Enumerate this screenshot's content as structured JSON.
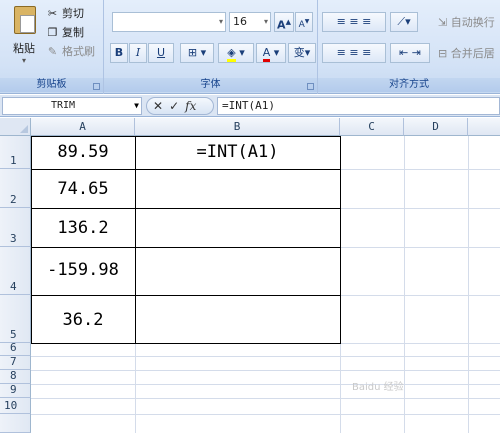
{
  "clipboard": {
    "group_label": "剪贴板",
    "paste_label": "粘贴",
    "cut_label": "剪切",
    "copy_label": "复制",
    "format_painter_label": "格式刷"
  },
  "font": {
    "group_label": "字体",
    "font_name": "",
    "font_size": "16",
    "grow_label": "A",
    "shrink_label": "A",
    "bold_label": "B",
    "italic_label": "I",
    "underline_label": "U",
    "phonetic_label": "变"
  },
  "alignment": {
    "group_label": "对齐方式",
    "wrap_text_label": "自动换行",
    "merge_center_label": "合并后居"
  },
  "formula_bar": {
    "name_box": "TRIM",
    "cancel_glyph": "✕",
    "enter_glyph": "✓",
    "fx_label": "fx",
    "formula": "=INT(A1)"
  },
  "columns": [
    "A",
    "B",
    "C",
    "D"
  ],
  "rows": [
    "1",
    "2",
    "3",
    "4",
    "5",
    "6",
    "7",
    "8",
    "9",
    "10"
  ],
  "cells": {
    "A1": "89.59",
    "A2": "74.65",
    "A3": "136.2",
    "A4": "-159.98",
    "A5": "36.2",
    "B1": "=INT(A1)"
  },
  "watermark": "Baidu 经验"
}
